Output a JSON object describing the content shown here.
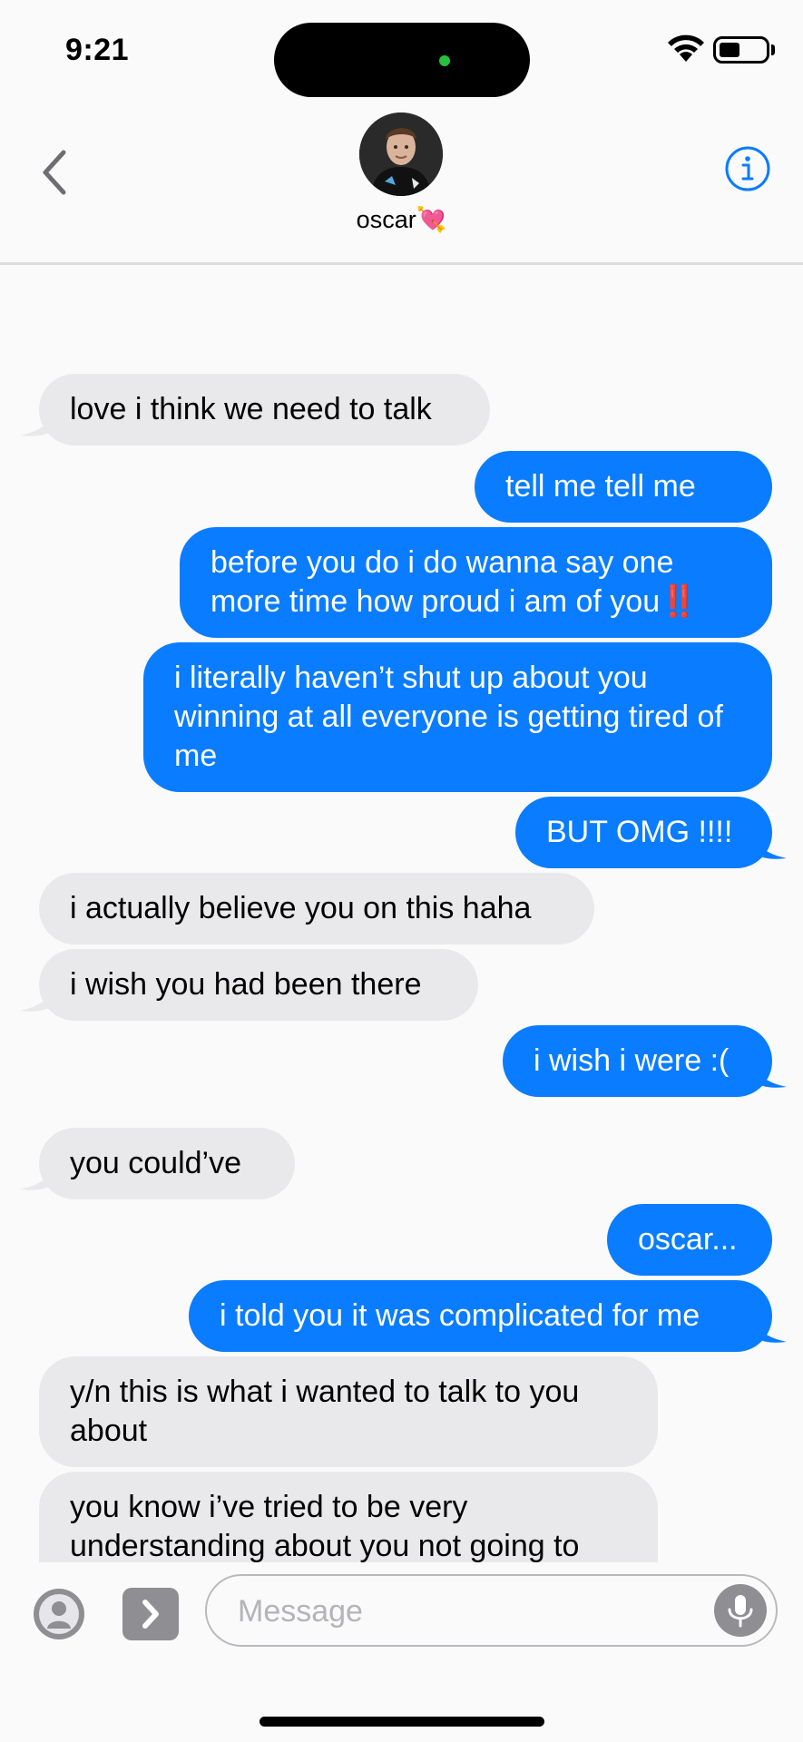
{
  "status_bar": {
    "time": "9:21",
    "icons": [
      "wifi-icon",
      "battery-icon"
    ]
  },
  "header": {
    "contact_name": "oscar💘",
    "icons": [
      "chevron-left-icon",
      "info-icon"
    ]
  },
  "messages": [
    {
      "side": "received",
      "text": "love i think we need to talk"
    },
    {
      "side": "sent",
      "text": "tell me tell me"
    },
    {
      "side": "sent",
      "text": "before you do i do wanna say one more time how proud i am of you",
      "emoji": "‼️"
    },
    {
      "side": "sent",
      "text": "i literally haven’t shut up about you winning at all everyone is getting tired of me"
    },
    {
      "side": "sent",
      "text": "BUT OMG !!!!"
    },
    {
      "side": "received",
      "text": "i actually believe you on this haha"
    },
    {
      "side": "received",
      "text": "i wish you had been there"
    },
    {
      "side": "sent",
      "text": "i wish i were :("
    },
    {
      "side": "received",
      "text": "you could’ve"
    },
    {
      "side": "sent",
      "text": "oscar..."
    },
    {
      "side": "sent",
      "text": "i told you it was complicated for me"
    },
    {
      "side": "received",
      "text": "y/n this is what i wanted to talk to you about"
    },
    {
      "side": "received",
      "text": "you know i’ve tried to be very understanding about you not going to any races and i respect it because i know it’s not possible because of your work and i would never interfere on that"
    }
  ],
  "composer": {
    "placeholder": "Message",
    "value": "",
    "icons": [
      "apps-icon",
      "chevron-right-icon",
      "microphone-icon"
    ]
  },
  "colors": {
    "sent_bubble": "#0a7cff",
    "received_bubble": "#e9e9eb",
    "background": "#fafafa"
  }
}
